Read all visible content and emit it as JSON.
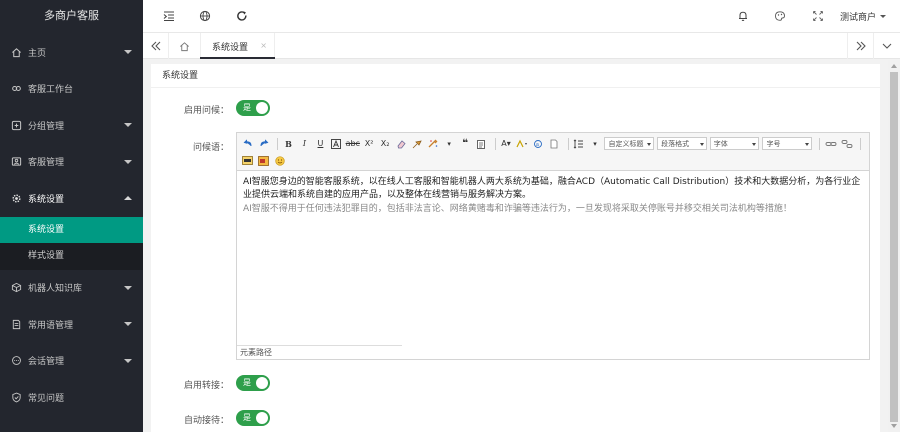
{
  "app": {
    "title": "多商户客服"
  },
  "sidebar": {
    "items": [
      {
        "label": "主页",
        "icon": "home-icon",
        "has_caret": true
      },
      {
        "label": "客服工作台",
        "icon": "link-icon",
        "has_caret": false
      },
      {
        "label": "分组管理",
        "icon": "group-icon",
        "has_caret": true
      },
      {
        "label": "客服管理",
        "icon": "user-icon",
        "has_caret": true
      },
      {
        "label": "系统设置",
        "icon": "gear-icon",
        "has_caret": true,
        "open": true
      },
      {
        "label": "机器人知识库",
        "icon": "box-icon",
        "has_caret": true
      },
      {
        "label": "常用语管理",
        "icon": "doc-icon",
        "has_caret": true
      },
      {
        "label": "会话管理",
        "icon": "chat-icon",
        "has_caret": true
      },
      {
        "label": "常见问题",
        "icon": "shield-icon",
        "has_caret": false
      }
    ],
    "sub_items": [
      {
        "label": "系统设置",
        "active": true
      },
      {
        "label": "样式设置",
        "active": false
      }
    ]
  },
  "topbar": {
    "icons": [
      "indent-icon",
      "globe-icon",
      "refresh-icon",
      "bell-icon",
      "skin-icon",
      "fullscreen-icon"
    ],
    "user_name": "测试商户"
  },
  "tabs": {
    "active_label": "系统设置",
    "close_glyph": "×"
  },
  "card": {
    "title": "系统设置"
  },
  "form": {
    "enable_greeting_label": "启用问候：",
    "greeting_label": "问候语：",
    "enable_transfer_label": "启用转接：",
    "auto_accept_label": "自动接待：",
    "switch_text": "是"
  },
  "editor": {
    "toolbar": {
      "heading_select": "自定义标题",
      "paragraph_select": "段落格式",
      "font_select": "字体",
      "size_select": "字号"
    },
    "paragraph_1": "AI智服您身边的智能客服系统，以在线人工客服和智能机器人两大系统为基础，融合ACD（Automatic Call Distribution）技术和大数据分析，为各行业企业提供云端和系统自建的应用产品，以及整体在线营销与服务解决方案。",
    "paragraph_2": "AI智服不得用于任何违法犯罪目的，包括非法言论、网络黄赌毒和诈骗等违法行为，一旦发现将采取关停账号并移交相关司法机构等措施！",
    "element_path": "元素路径"
  },
  "colors": {
    "sidebar_bg": "#23262e",
    "active_submenu": "#009a83",
    "switch_on": "#2e9f4b"
  }
}
